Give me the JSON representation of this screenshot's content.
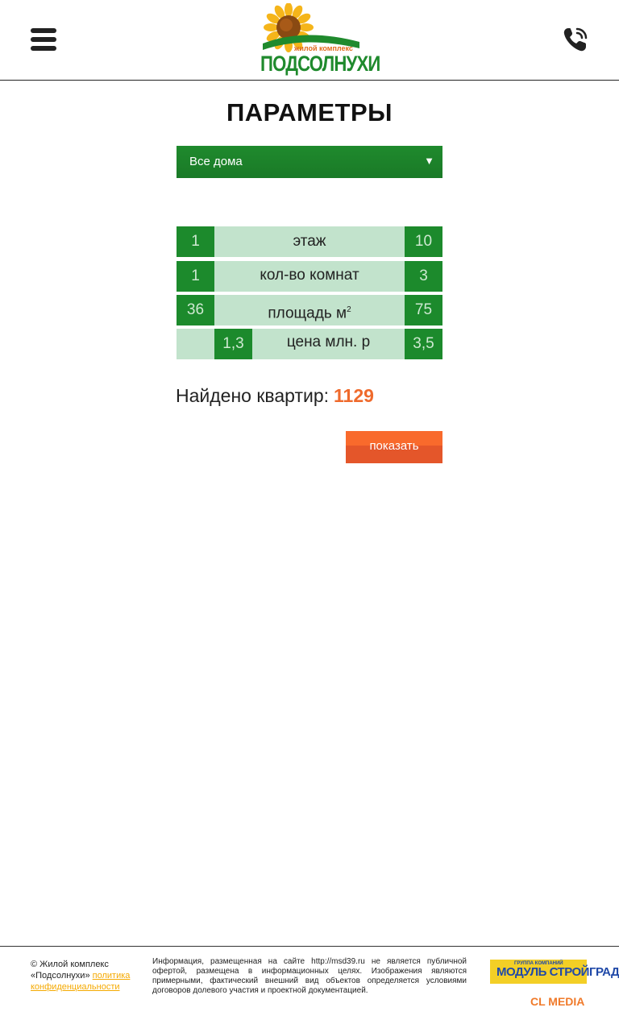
{
  "header": {
    "logo_subtitle": "жилой комплекс",
    "logo_title": "ПОДСОЛНУХИ",
    "menu_icon": "hamburger-menu-icon",
    "phone_icon": "phone-icon"
  },
  "page": {
    "title": "ПАРАМЕТРЫ"
  },
  "filter": {
    "house_select": "Все дома",
    "rows": [
      {
        "label": "этаж",
        "min": "1",
        "max": "10"
      },
      {
        "label": "кол-во комнат",
        "min": "1",
        "max": "3"
      },
      {
        "label": "площадь м",
        "label_sup": "2",
        "min": "36",
        "max": "75"
      },
      {
        "label": "цена млн. р",
        "min": "1,3",
        "max": "3,5"
      }
    ]
  },
  "result": {
    "label": "Найдено квартир:",
    "count": "1129"
  },
  "show_button": "показать",
  "footer": {
    "copyright": "© Жилой комплекс «Подсолнухи»",
    "privacy_link": "политика конфиденциальности",
    "disclaimer": "Информация, размещенная на сайте http://msd39.ru не является публичной офертой, размещена в информационных целях. Изображения являются примерными, фактический внешний вид объектов определяется условиями договоров долевого участия и проектной документацией.",
    "partner_small": "ГРУППА КОМПАНИЙ",
    "partner_name": "МОДУЛЬ СТРОЙГРАД",
    "developer_credit": "CL MEDIA"
  },
  "colors": {
    "green": "#1c8a2c",
    "light_green": "#c2e3cc",
    "orange": "#ef6a2c"
  }
}
